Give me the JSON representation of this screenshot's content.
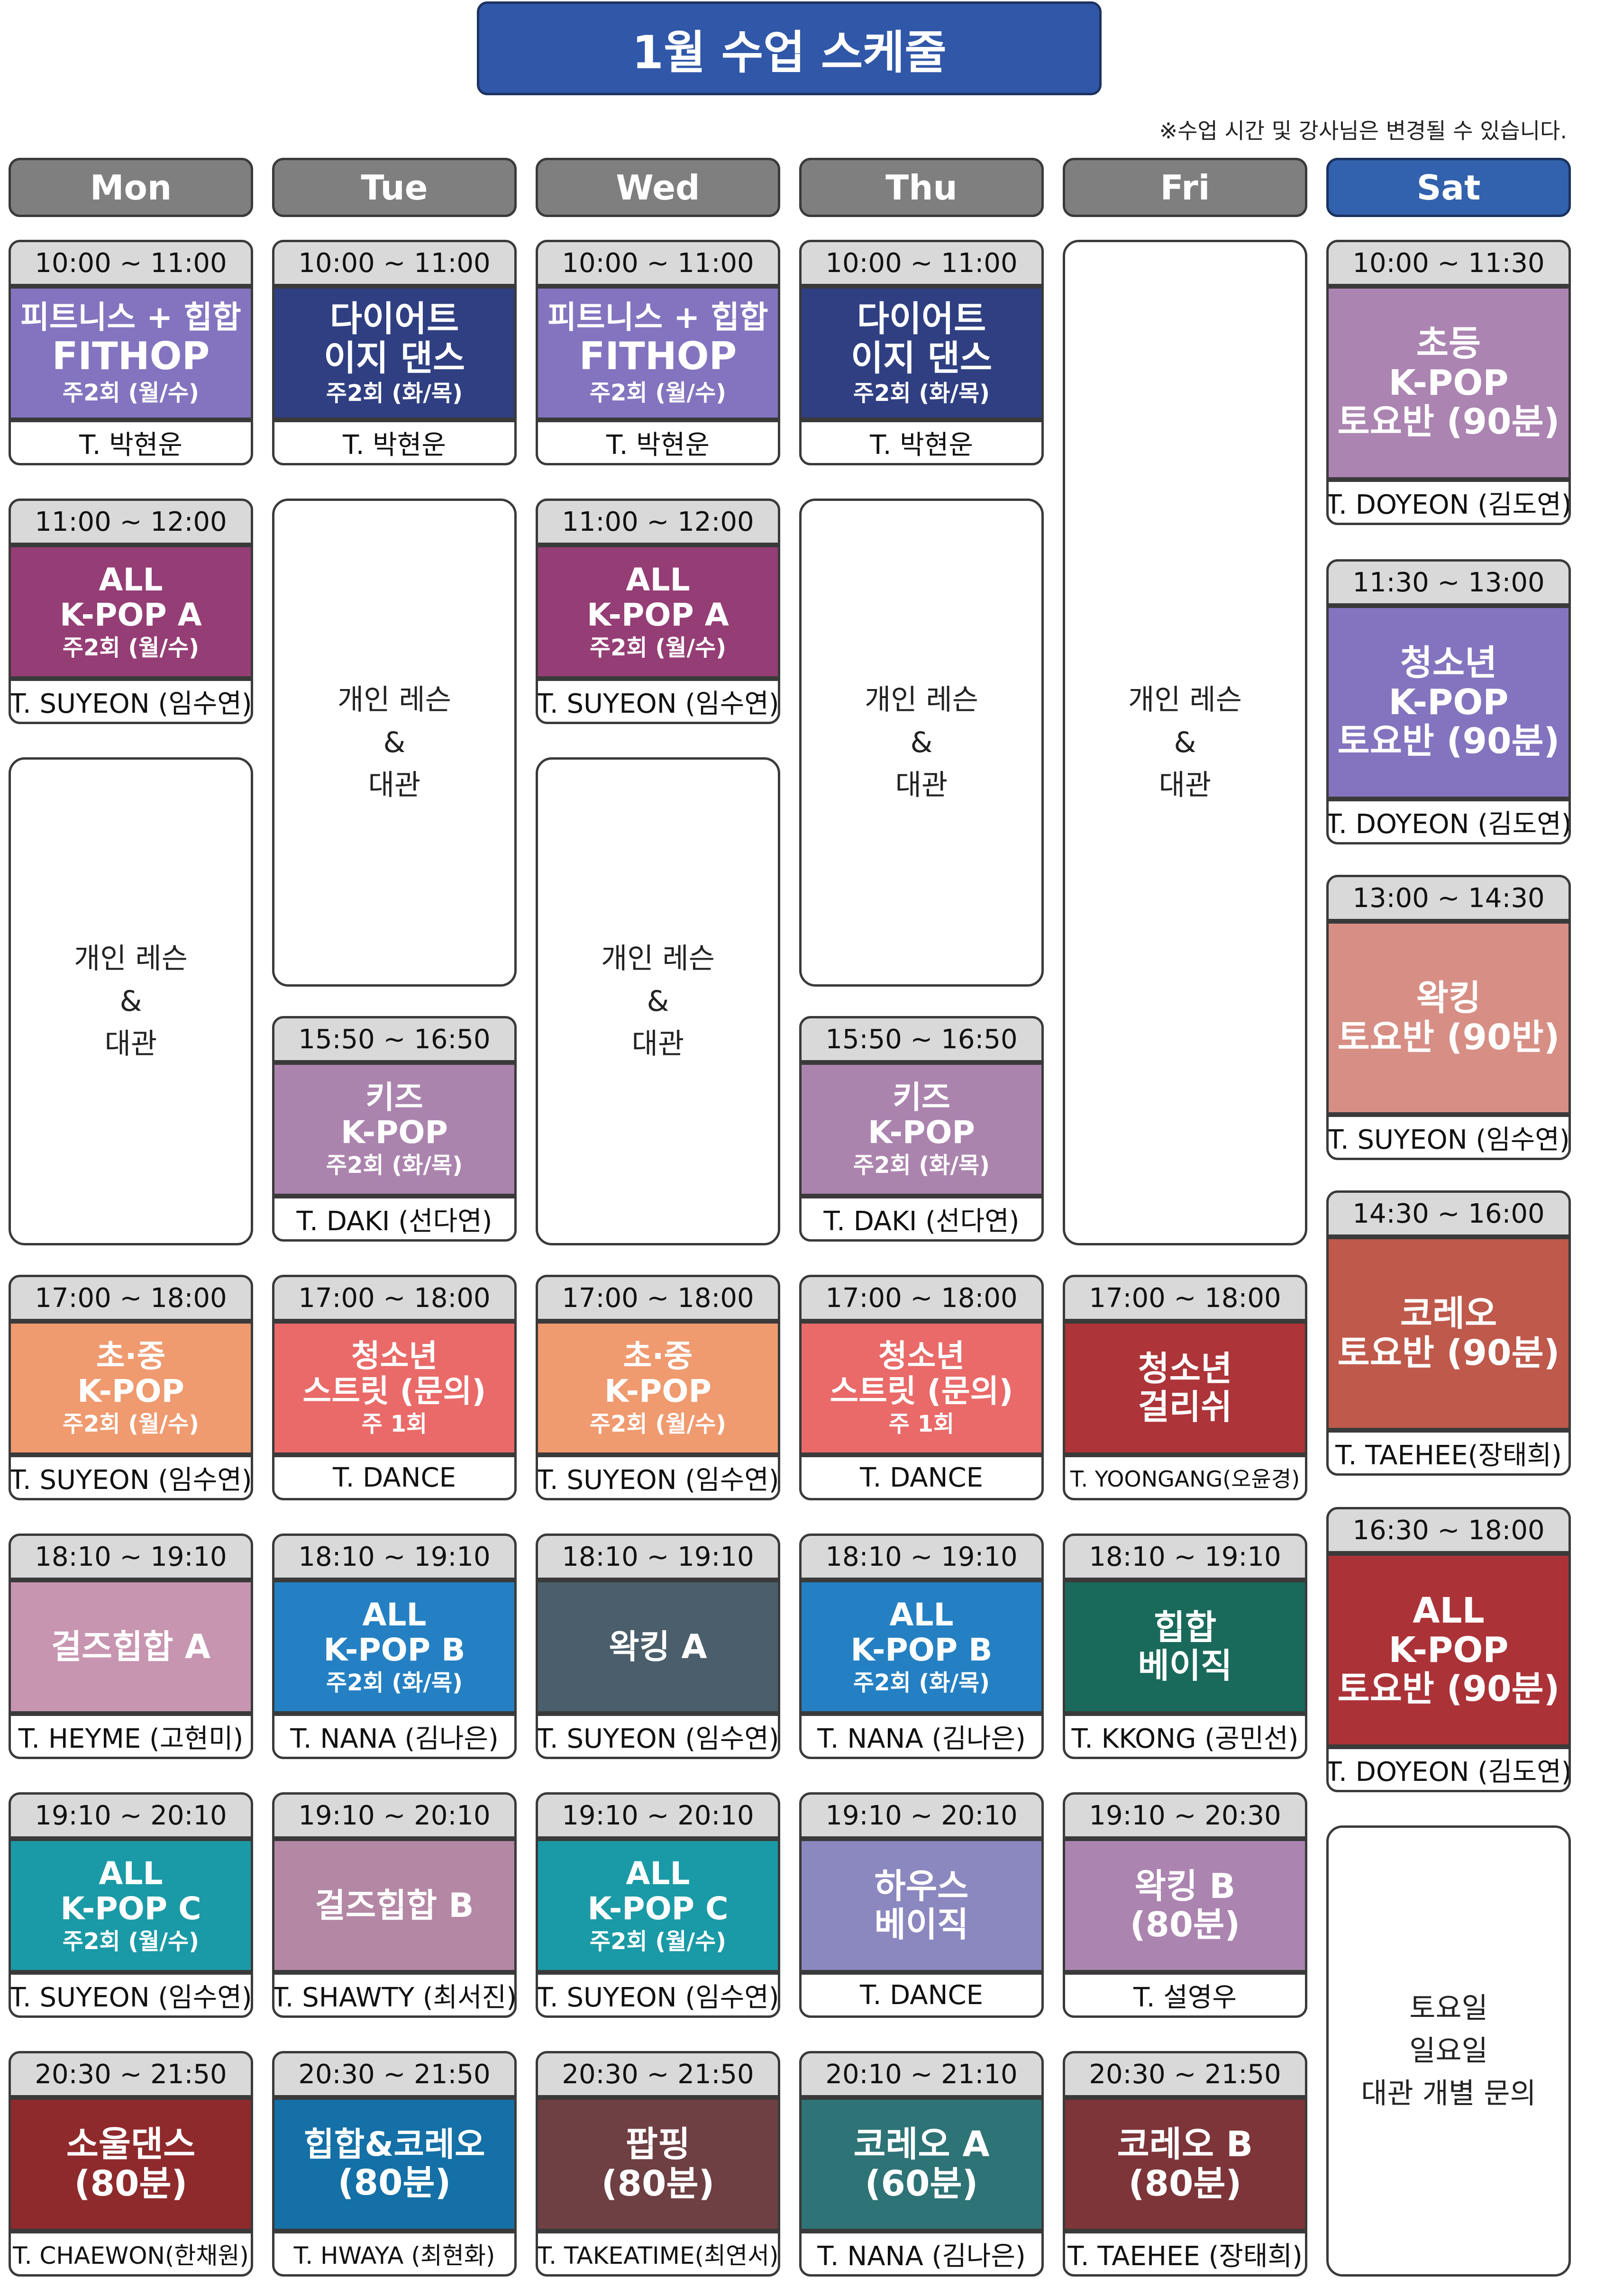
{
  "header": {
    "title": "1월 수업 스케줄",
    "note": "※수업 시간 및 강사님은 변경될 수 있습니다."
  },
  "days": [
    "Mon",
    "Tue",
    "Wed",
    "Thu",
    "Fri",
    "Sat"
  ],
  "colors": {
    "title": "#3057a8",
    "day": "#7f7f7f",
    "sat_day": "#3261ad",
    "time_bar": "#d9d9d9"
  },
  "free": {
    "lesson": [
      "개인 레슨",
      "&",
      "대관"
    ],
    "sat_bottom": [
      "토요일",
      "일요일",
      "대관 개별 문의"
    ]
  },
  "mon": {
    "c1": {
      "time": "10:00 ~ 11:00",
      "l1": "피트니스 + 힙합",
      "l2": "FITHOP",
      "sub": "주2회 (월/수)",
      "teacher": "T. 박현운"
    },
    "c2": {
      "time": "11:00 ~ 12:00",
      "l1": "ALL",
      "l2": "K-POP A",
      "sub": "주2회 (월/수)",
      "teacher": "T. SUYEON (임수연)"
    },
    "c3": {
      "time": "17:00 ~ 18:00",
      "l1": "초·중",
      "l2": "K-POP",
      "sub": "주2회 (월/수)",
      "teacher": "T. SUYEON (임수연)"
    },
    "c4": {
      "time": "18:10 ~ 19:10",
      "l1": "걸즈힙합 A",
      "teacher": "T. HEYME (고현미)"
    },
    "c5": {
      "time": "19:10 ~ 20:10",
      "l1": "ALL",
      "l2": "K-POP C",
      "sub": "주2회 (월/수)",
      "teacher": "T. SUYEON (임수연)"
    },
    "c6": {
      "time": "20:30 ~ 21:50",
      "l1": "소울댄스",
      "l2": "(80분)",
      "teacher": "T. CHAEWON(한채원)"
    }
  },
  "tue": {
    "c1": {
      "time": "10:00 ~ 11:00",
      "l1": "다이어트",
      "l2": "이지 댄스",
      "sub": "주2회 (화/목)",
      "teacher": "T. 박현운"
    },
    "c2": {
      "time": "15:50 ~ 16:50",
      "l1": "키즈",
      "l2": "K-POP",
      "sub": "주2회 (화/목)",
      "teacher": "T. DAKI (선다연)"
    },
    "c3": {
      "time": "17:00 ~ 18:00",
      "l1": "청소년",
      "l2": "스트릿 (문의)",
      "sub": "주 1회",
      "teacher": "T. DANCE"
    },
    "c4": {
      "time": "18:10 ~ 19:10",
      "l1": "ALL",
      "l2": "K-POP B",
      "sub": "주2회 (화/목)",
      "teacher": "T. NANA (김나은)"
    },
    "c5": {
      "time": "19:10 ~ 20:10",
      "l1": "걸즈힙합 B",
      "teacher": "T. SHAWTY (최서진)"
    },
    "c6": {
      "time": "20:30 ~ 21:50",
      "l1": "힙합&코레오",
      "l2": "(80분)",
      "teacher": "T. HWAYA (최현화)"
    }
  },
  "wed": {
    "c1": {
      "time": "10:00 ~ 11:00",
      "l1": "피트니스 + 힙합",
      "l2": "FITHOP",
      "sub": "주2회 (월/수)",
      "teacher": "T. 박현운"
    },
    "c2": {
      "time": "11:00 ~ 12:00",
      "l1": "ALL",
      "l2": "K-POP A",
      "sub": "주2회 (월/수)",
      "teacher": "T. SUYEON (임수연)"
    },
    "c3": {
      "time": "17:00 ~ 18:00",
      "l1": "초·중",
      "l2": "K-POP",
      "sub": "주2회 (월/수)",
      "teacher": "T. SUYEON (임수연)"
    },
    "c4": {
      "time": "18:10 ~ 19:10",
      "l1": "왁킹 A",
      "teacher": "T. SUYEON (임수연)"
    },
    "c5": {
      "time": "19:10 ~ 20:10",
      "l1": "ALL",
      "l2": "K-POP C",
      "sub": "주2회 (월/수)",
      "teacher": "T. SUYEON (임수연)"
    },
    "c6": {
      "time": "20:30 ~ 21:50",
      "l1": "팝핑",
      "l2": "(80분)",
      "teacher": "T. TAKEATIME(최연서)"
    }
  },
  "thu": {
    "c1": {
      "time": "10:00 ~ 11:00",
      "l1": "다이어트",
      "l2": "이지 댄스",
      "sub": "주2회 (화/목)",
      "teacher": "T. 박현운"
    },
    "c2": {
      "time": "15:50 ~ 16:50",
      "l1": "키즈",
      "l2": "K-POP",
      "sub": "주2회 (화/목)",
      "teacher": "T. DAKI (선다연)"
    },
    "c3": {
      "time": "17:00 ~ 18:00",
      "l1": "청소년",
      "l2": "스트릿 (문의)",
      "sub": "주 1회",
      "teacher": "T. DANCE"
    },
    "c4": {
      "time": "18:10 ~ 19:10",
      "l1": "ALL",
      "l2": "K-POP B",
      "sub": "주2회 (화/목)",
      "teacher": "T. NANA (김나은)"
    },
    "c5": {
      "time": "19:10 ~ 20:10",
      "l1": "하우스",
      "l2": "베이직",
      "teacher": "T. DANCE"
    },
    "c6": {
      "time": "20:10 ~ 21:10",
      "l1": "코레오 A",
      "l2": "(60분)",
      "teacher": "T. NANA (김나은)"
    }
  },
  "fri": {
    "c1": {
      "time": "17:00 ~ 18:00",
      "l1": "청소년",
      "l2": "걸리쉬",
      "teacher": "T. YOONGANG(오윤경)"
    },
    "c2": {
      "time": "18:10 ~ 19:10",
      "l1": "힙합",
      "l2": "베이직",
      "teacher": "T. KKONG (공민선)"
    },
    "c3": {
      "time": "19:10 ~ 20:30",
      "l1": "왁킹 B",
      "l2": "(80분)",
      "teacher": "T. 설영우"
    },
    "c4": {
      "time": "20:30 ~ 21:50",
      "l1": "코레오 B",
      "l2": "(80분)",
      "teacher": "T. TAEHEE (장태희)"
    }
  },
  "sat": {
    "c1": {
      "time": "10:00 ~ 11:30",
      "l1": "초등",
      "l2": "K-POP",
      "l3": "토요반 (90분)",
      "teacher": "T. DOYEON (김도연)"
    },
    "c2": {
      "time": "11:30 ~ 13:00",
      "l1": "청소년",
      "l2": "K-POP",
      "l3": "토요반 (90분)",
      "teacher": "T. DOYEON (김도연)"
    },
    "c3": {
      "time": "13:00 ~ 14:30",
      "l1": "왁킹",
      "l2": "토요반 (90반)",
      "teacher": "T. SUYEON (임수연)"
    },
    "c4": {
      "time": "14:30 ~ 16:00",
      "l1": "코레오",
      "l2": "토요반 (90분)",
      "teacher": "T. TAEHEE(장태희)"
    },
    "c5": {
      "time": "16:30 ~ 18:00",
      "l1": "ALL",
      "l2": "K-POP",
      "l3": "토요반 (90분)",
      "teacher": "T. DOYEON (김도연)"
    }
  }
}
